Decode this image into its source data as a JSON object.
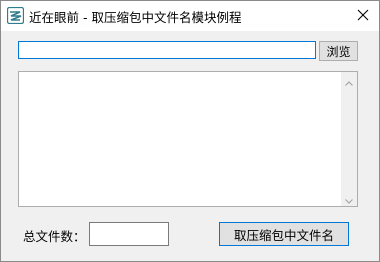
{
  "window": {
    "title": "近在眼前 - 取压缩包中文件名模块例程",
    "icon": "app-icon",
    "close_icon": "close-icon"
  },
  "file_path": {
    "value": "",
    "browse_label": "浏览"
  },
  "file_list": {
    "items": []
  },
  "footer": {
    "count_label": "总文件数：",
    "count_value": "",
    "extract_label": "取压缩包中文件名"
  },
  "colors": {
    "accent": "#0078d7",
    "icon": "#2f7d8c"
  }
}
